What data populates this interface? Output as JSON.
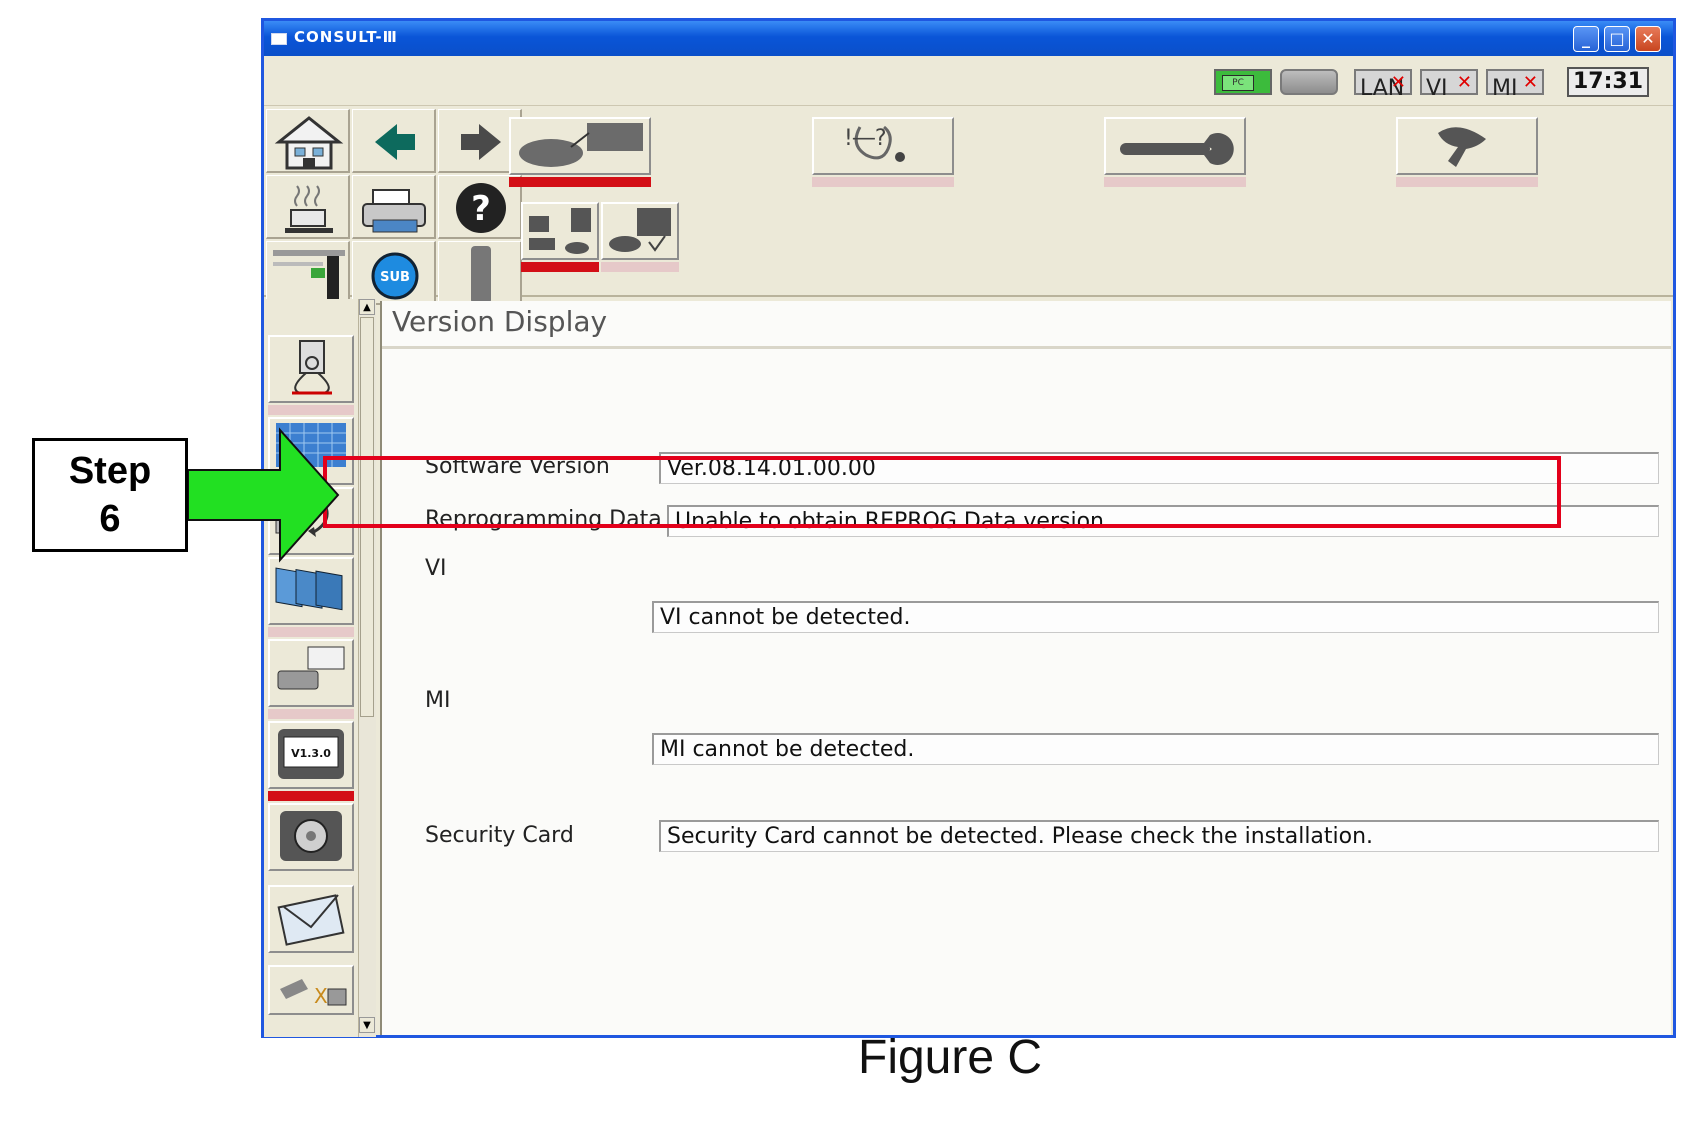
{
  "window": {
    "title": "CONSULT-Ⅲ",
    "controls": [
      "_",
      "□",
      "✕"
    ]
  },
  "statusbar": {
    "pc_label": "PC",
    "lan_label": "LAN",
    "vi_label": "VI",
    "mi_label": "MI",
    "x_mark": "✕",
    "clock": "17:31"
  },
  "toolbar": {
    "sub_label": "SUB",
    "help_label": "?",
    "diag_label": "!―?"
  },
  "leftnav": {
    "version_icon_label": "V1.3.0"
  },
  "content": {
    "title": "Version Display",
    "software_version_label": "Software Version",
    "software_version_value": "Ver.08.14.01.00.00",
    "reprog_label": "Reprogramming Data",
    "reprog_value": "Unable to obtain REPROG Data version.",
    "vi_label": "VI",
    "vi_value": "VI cannot be detected.",
    "mi_label": "MI",
    "mi_value": "MI cannot be detected.",
    "security_label": "Security Card",
    "security_value": "Security Card cannot be detected. Please check the installation."
  },
  "annotation": {
    "step_word": "Step",
    "step_num": "6",
    "arrow_color": "#22e022",
    "box_color": "#e3001b"
  },
  "caption": "Figure C"
}
